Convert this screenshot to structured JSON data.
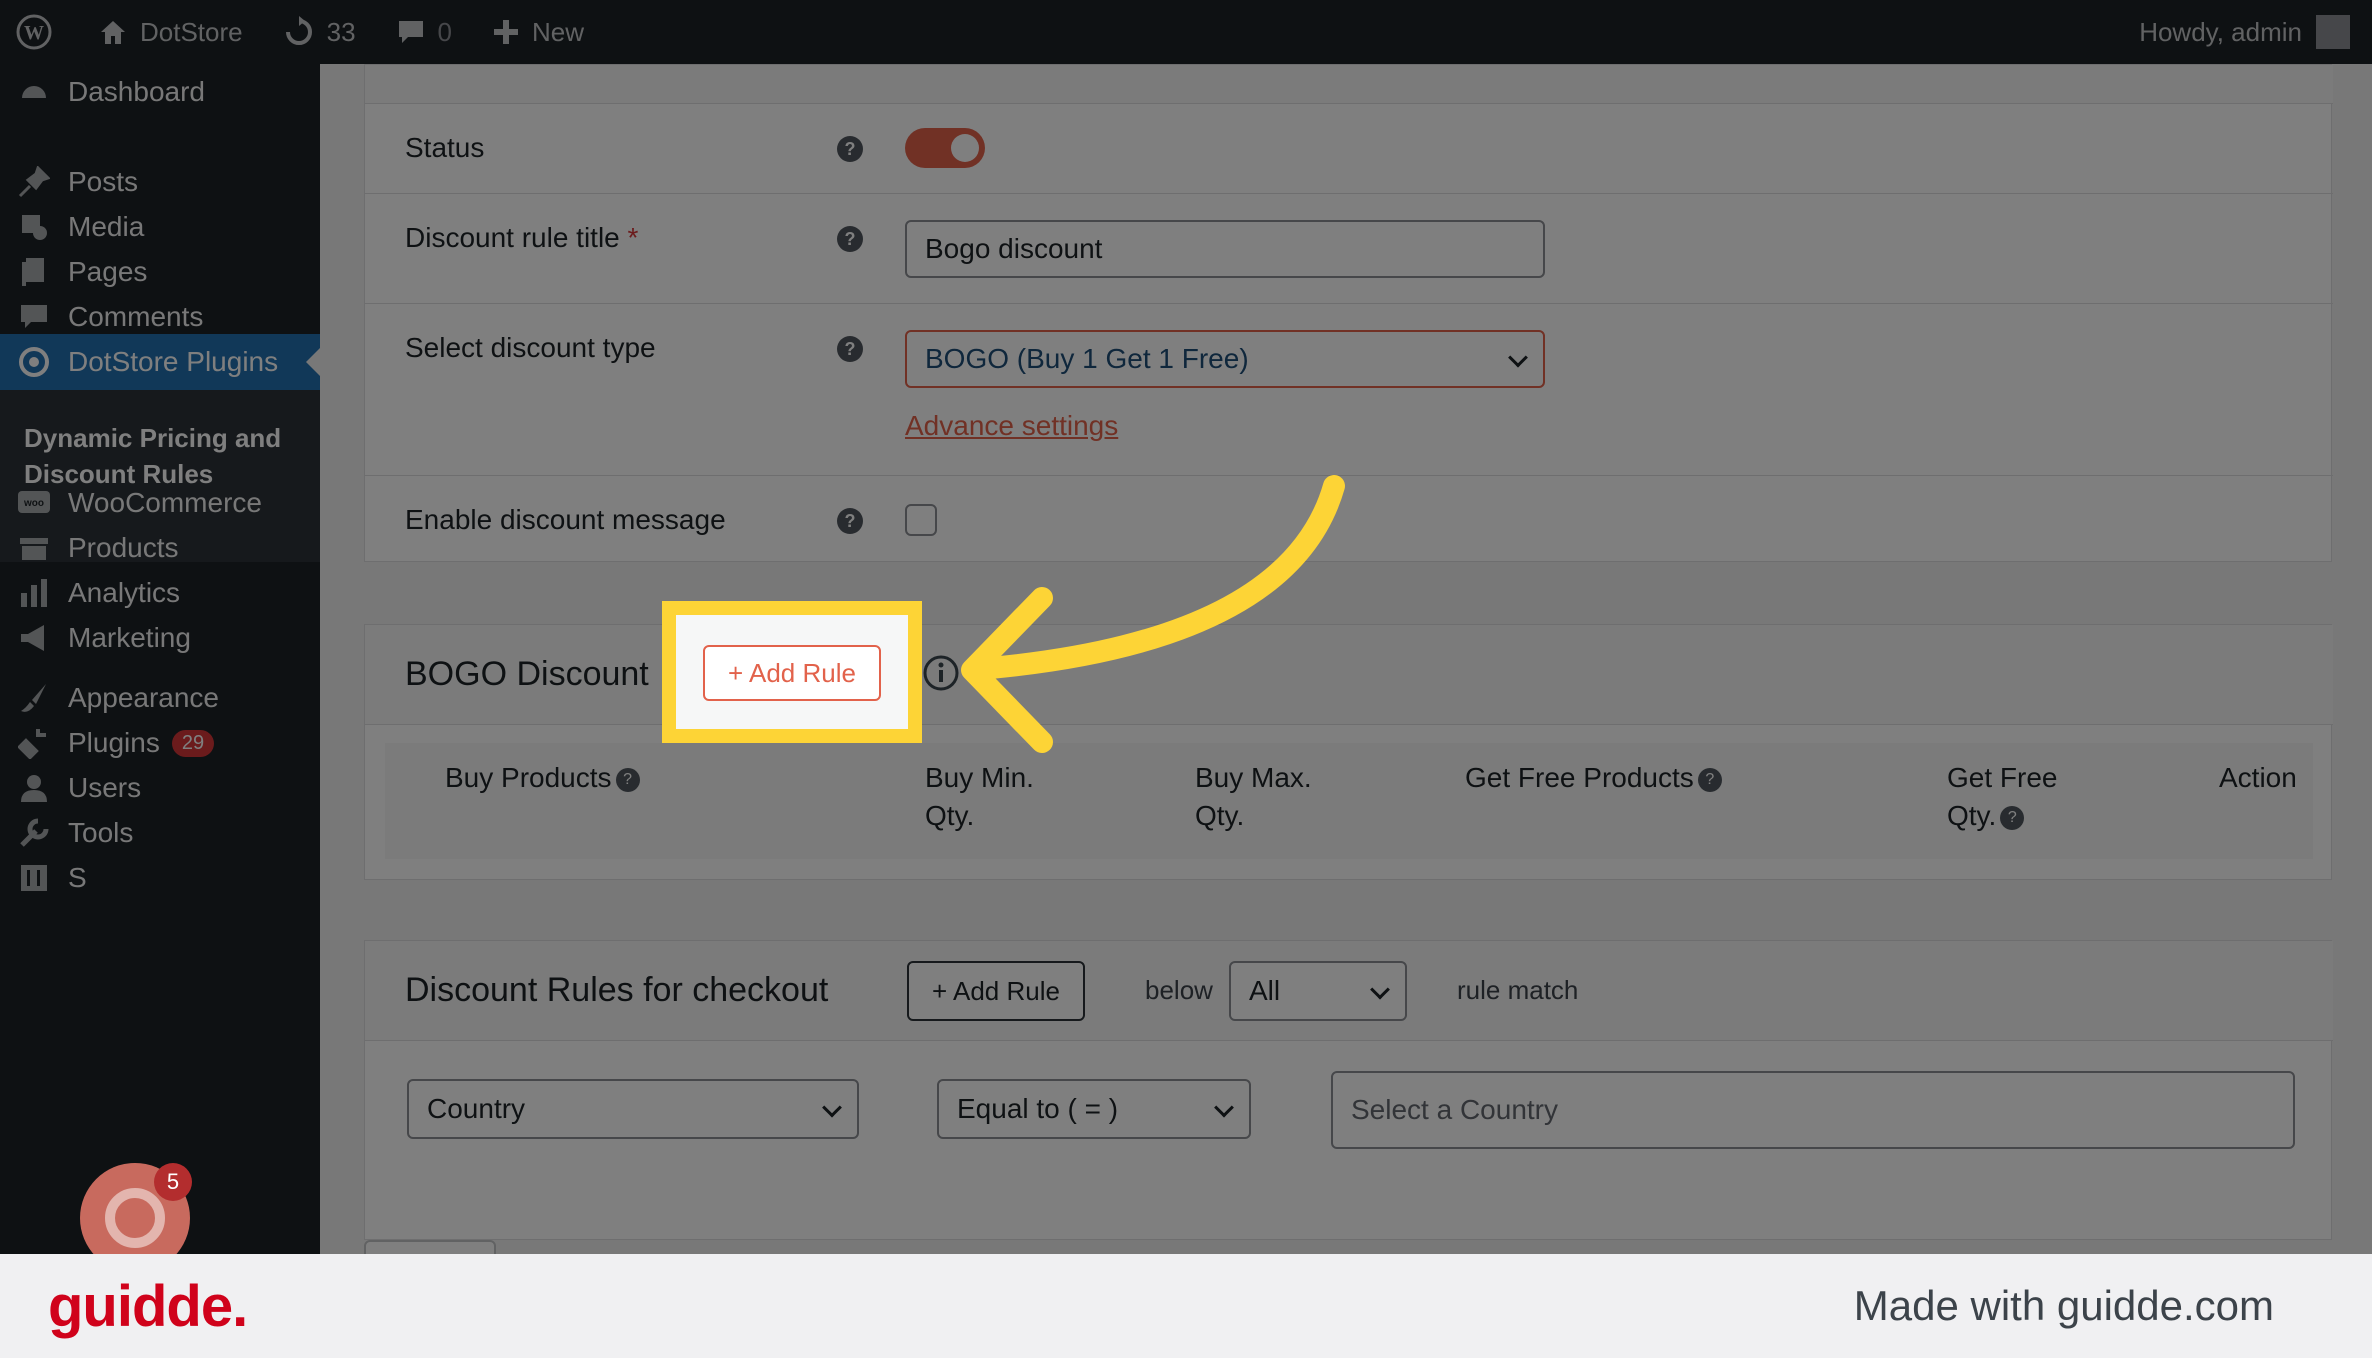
{
  "adminbar": {
    "site_name": "DotStore",
    "updates_count": "33",
    "comments_count": "0",
    "new_label": "New",
    "howdy": "Howdy, admin"
  },
  "sidebar": {
    "items": [
      {
        "label": "Dashboard",
        "icon": "dashboard-icon"
      },
      {
        "label": "Posts",
        "icon": "pin-icon"
      },
      {
        "label": "Media",
        "icon": "media-icon"
      },
      {
        "label": "Pages",
        "icon": "pages-icon"
      },
      {
        "label": "Comments",
        "icon": "comment-icon"
      },
      {
        "label": "DotStore Plugins",
        "icon": "target-icon"
      },
      {
        "label": "WooCommerce",
        "icon": "woo-icon"
      },
      {
        "label": "Products",
        "icon": "box-icon"
      },
      {
        "label": "Analytics",
        "icon": "bar-chart-icon"
      },
      {
        "label": "Marketing",
        "icon": "megaphone-icon"
      },
      {
        "label": "Appearance",
        "icon": "paintbrush-icon"
      },
      {
        "label": "Plugins",
        "icon": "plugin-icon",
        "badge": "29"
      },
      {
        "label": "Users",
        "icon": "user-icon"
      },
      {
        "label": "Tools",
        "icon": "wrench-icon"
      },
      {
        "label": "S",
        "icon": "settings-icon"
      }
    ],
    "submenu_label": "Dynamic Pricing and Discount Rules"
  },
  "form": {
    "status_label": "Status",
    "title_label": "Discount rule title",
    "required_mark": "*",
    "title_value": "Bogo discount",
    "type_label": "Select discount type",
    "type_value": "BOGO (Buy 1 Get 1 Free)",
    "advance_link": "Advance settings",
    "message_label": "Enable discount message"
  },
  "bogo": {
    "title": "BOGO Discount",
    "add_rule": "+ Add Rule",
    "columns": [
      "Buy Products",
      "Buy Min.\nQty.",
      "Buy Max.\nQty.",
      "Get Free Products",
      "Get Free\nQty.",
      "Action"
    ]
  },
  "checkout": {
    "title": "Discount Rules for checkout",
    "add_rule": "+ Add Rule",
    "below": "below",
    "match_value": "All",
    "rule_match": "rule match",
    "condition_value": "Country",
    "operator_value": "Equal to ( = )",
    "country_placeholder": "Select a Country"
  },
  "bubble_badge": "5",
  "footer": {
    "logo": "guidde.",
    "made_with": "Made with guidde.com"
  },
  "colors": {
    "accent": "#e2624b",
    "highlight": "#fdd436",
    "admin_bg": "#1d2327",
    "active_menu": "#2271b1"
  }
}
